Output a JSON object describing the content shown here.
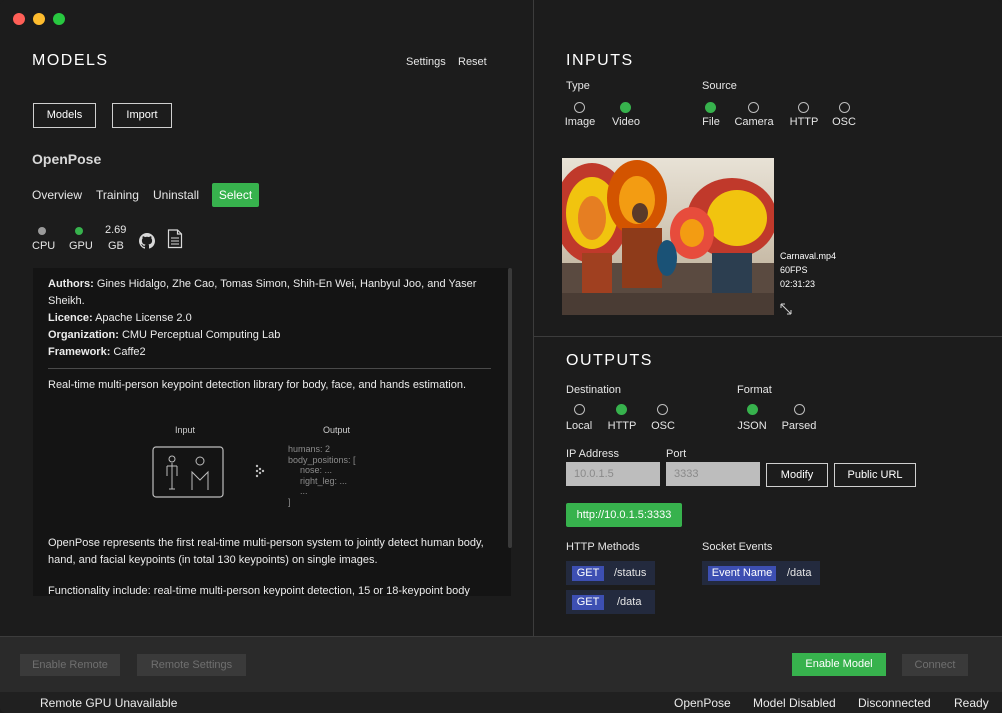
{
  "window": {
    "colors": {
      "close": "#ff5f57",
      "minimize": "#febc2e",
      "maximize": "#28c840"
    }
  },
  "models": {
    "title": "MODELS",
    "settings": "Settings",
    "reset": "Reset",
    "models_btn": "Models",
    "import_btn": "Import",
    "model_name": "OpenPose",
    "tabs": {
      "overview": "Overview",
      "training": "Training",
      "uninstall": "Uninstall",
      "select": "Select"
    },
    "hw": {
      "cpu": "CPU",
      "gpu": "GPU",
      "size_value": "2.69",
      "size_unit": "GB"
    },
    "info": {
      "authors_label": "Authors:",
      "authors": "Gines Hidalgo, Zhe Cao, Tomas Simon, Shih-En Wei, Hanbyul Joo, and Yaser Sheikh.",
      "licence_label": "Licence:",
      "licence": "Apache License 2.0",
      "org_label": "Organization:",
      "org": "CMU Perceptual Computing Lab",
      "framework_label": "Framework:",
      "framework": "Caffe2",
      "description": "Real-time multi-person keypoint detection library for body, face, and hands estimation.",
      "diagram_input": "Input",
      "diagram_output": "Output",
      "out1": "humans: 2",
      "out2": "body_positions: [",
      "out3": "nose: ...",
      "out4": "right_leg: ...",
      "out5": "...",
      "out6": "]",
      "para2": "OpenPose represents the first real-time multi-person system to jointly detect human body, hand, and facial keypoints (in total 130 keypoints) on single images.",
      "para3": "Functionality include: real-time multi-person keypoint detection, 15 or 18-keypoint body"
    }
  },
  "inputs": {
    "title": "INPUTS",
    "type_label": "Type",
    "type_options": [
      "Image",
      "Video"
    ],
    "type_selected": "Video",
    "source_label": "Source",
    "source_options": [
      "File",
      "Camera",
      "HTTP",
      "OSC"
    ],
    "source_selected": "File",
    "file_name": "Carnaval.mp4",
    "fps": "60FPS",
    "duration": "02:31:23"
  },
  "outputs": {
    "title": "OUTPUTS",
    "destination_label": "Destination",
    "destination_options": [
      "Local",
      "HTTP",
      "OSC"
    ],
    "destination_selected": "HTTP",
    "format_label": "Format",
    "format_options": [
      "JSON",
      "Parsed"
    ],
    "format_selected": "JSON",
    "ip_label": "IP Address",
    "ip_value": "10.0.1.5",
    "port_label": "Port",
    "port_value": "3333",
    "modify_btn": "Modify",
    "public_url_btn": "Public URL",
    "url": "http://10.0.1.5:3333",
    "http_methods_label": "HTTP Methods",
    "methods": [
      {
        "verb": "GET",
        "path": "/status"
      },
      {
        "verb": "GET",
        "path": "/data"
      }
    ],
    "socket_label": "Socket Events",
    "socket_chip": "Event Name",
    "socket_path": "/data"
  },
  "bottom": {
    "enable_remote": "Enable Remote",
    "remote_settings": "Remote Settings",
    "enable_model": "Enable Model",
    "connect": "Connect"
  },
  "status": {
    "remote": "Remote GPU Unavailable",
    "model": "OpenPose",
    "model_state": "Model Disabled",
    "connection": "Disconnected",
    "ready": "Ready"
  },
  "accent": "#37b24d"
}
